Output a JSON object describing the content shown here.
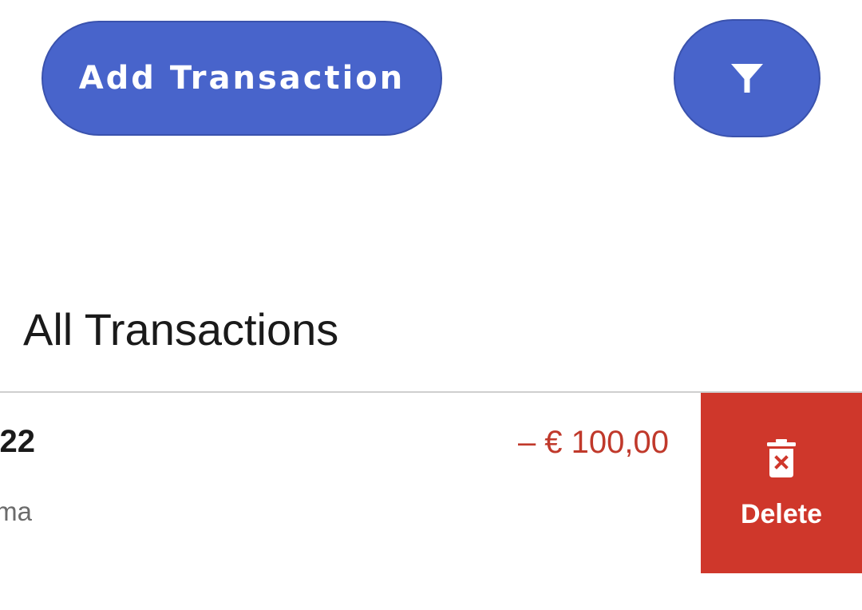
{
  "toolbar": {
    "add_label": "Add Transaction",
    "filter_icon": "filter-icon"
  },
  "section": {
    "title": "All Transactions"
  },
  "transaction": {
    "title_partial": "22",
    "subtitle_partial": "ma",
    "amount": "– € 100,00",
    "delete_label": "Delete",
    "delete_icon": "trash-icon"
  },
  "colors": {
    "primary": "#4864cb",
    "danger": "#cf372b",
    "amount_negative": "#c0392b",
    "divider": "#cfcfcf"
  }
}
